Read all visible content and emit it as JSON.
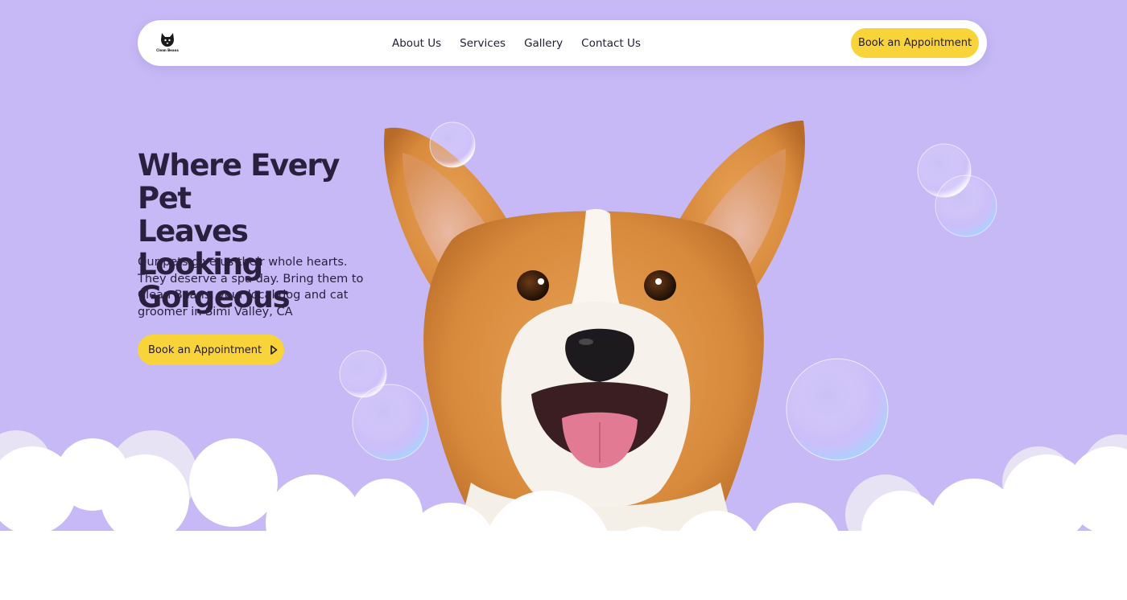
{
  "nav": {
    "logo_text": "Clean Beans",
    "links": [
      "About Us",
      "Services",
      "Gallery",
      "Contact Us"
    ],
    "cta_label": "Book an Appointment"
  },
  "hero": {
    "title_lines": [
      "Where Every Pet",
      "Leaves Looking",
      "Gorgeous"
    ],
    "subtitle": "Our pets give us their whole hearts. They deserve a spa day. Bring them to Clean Beans, your local dog and cat groomer in Simi Valley, CA",
    "cta_label": "Book an Appointment",
    "cta_icon": "play-arrow-icon",
    "image": "corgi-dog-photo"
  },
  "colors": {
    "background": "#c6b9f5",
    "accent": "#f8d43a",
    "text": "#2a1f3d",
    "cloud": "#ffffff"
  }
}
